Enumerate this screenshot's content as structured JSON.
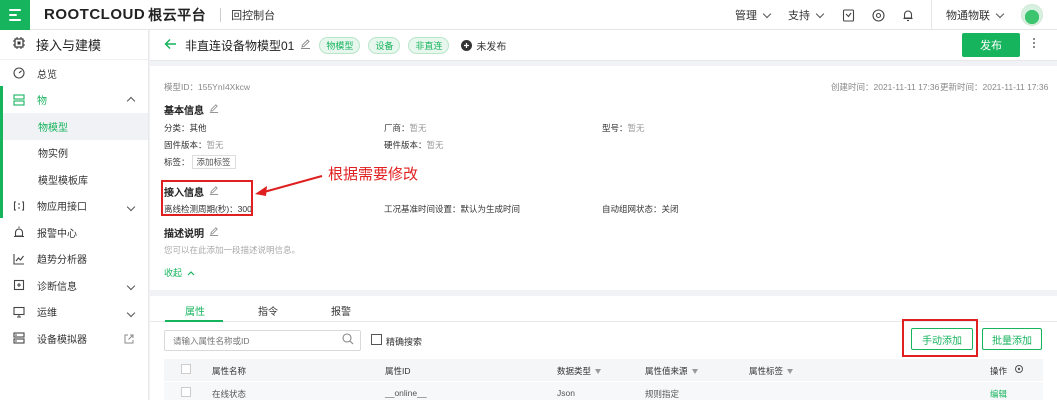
{
  "topbar": {
    "logo_brand": "ROOTCLOUD",
    "logo_cn": "根云平台",
    "console_link": "回控制台",
    "menu_manage": "管理",
    "menu_support": "支持",
    "org_name": "物通物联"
  },
  "sidebar": {
    "header": "接入与建模",
    "items": [
      {
        "label": "总览",
        "icon": "dashboard-icon"
      },
      {
        "label": "物",
        "icon": "things-icon"
      },
      {
        "label": "物应用接口",
        "icon": "api-icon"
      },
      {
        "label": "报警中心",
        "icon": "alarm-icon"
      },
      {
        "label": "趋势分析器",
        "icon": "trend-icon"
      },
      {
        "label": "诊断信息",
        "icon": "diagnose-icon"
      },
      {
        "label": "运维",
        "icon": "ops-icon"
      },
      {
        "label": "设备模拟器",
        "icon": "simulator-icon"
      }
    ],
    "sub_items": [
      "物模型",
      "物实例",
      "模型模板库"
    ]
  },
  "page": {
    "title": "非直连设备物模型01",
    "tags": [
      "物模型",
      "设备",
      "非直连"
    ],
    "status": "未发布",
    "publish_label": "发布"
  },
  "meta": {
    "model_id": "模型ID：155YnI4Xkcw",
    "created": "创建时间：2021-11-11 17:36",
    "updated": "更新时间：2021-11-11 17:36"
  },
  "basic": {
    "title": "基本信息",
    "category": "分类：其他",
    "vendor_label": "厂商：",
    "vendor_value": "暂无",
    "model_label": "型号：",
    "model_value": "暂无",
    "firmware_label": "固件版本：",
    "firmware_value": "暂无",
    "hardware_label": "硬件版本：",
    "hardware_value": "暂无",
    "tags_label": "标签：",
    "add_tag": "添加标签"
  },
  "access": {
    "title": "接入信息",
    "offline_period": "离线检测周期(秒)：300",
    "time_setting": "工况基准时间设置：默认为生成时间",
    "auto_network": "自动组网状态：关闭"
  },
  "desc": {
    "title": "描述说明",
    "placeholder": "您可以在此添加一段描述说明信息。",
    "collapse": "收起"
  },
  "annotation": {
    "text": "根据需要修改"
  },
  "tabs": [
    "属性",
    "指令",
    "报警"
  ],
  "toolbar": {
    "search_placeholder": "请输入属性名称或ID",
    "exact_search": "精确搜索",
    "manual_add": "手动添加",
    "batch_add": "批量添加"
  },
  "table": {
    "headers": [
      "属性名称",
      "属性ID",
      "数据类型",
      "属性值来源",
      "属性标签",
      "操作"
    ],
    "rows": [
      {
        "name": "在线状态",
        "id": "__online__",
        "type": "Json",
        "source": "规则指定",
        "tag": "",
        "action": "编辑"
      }
    ]
  }
}
